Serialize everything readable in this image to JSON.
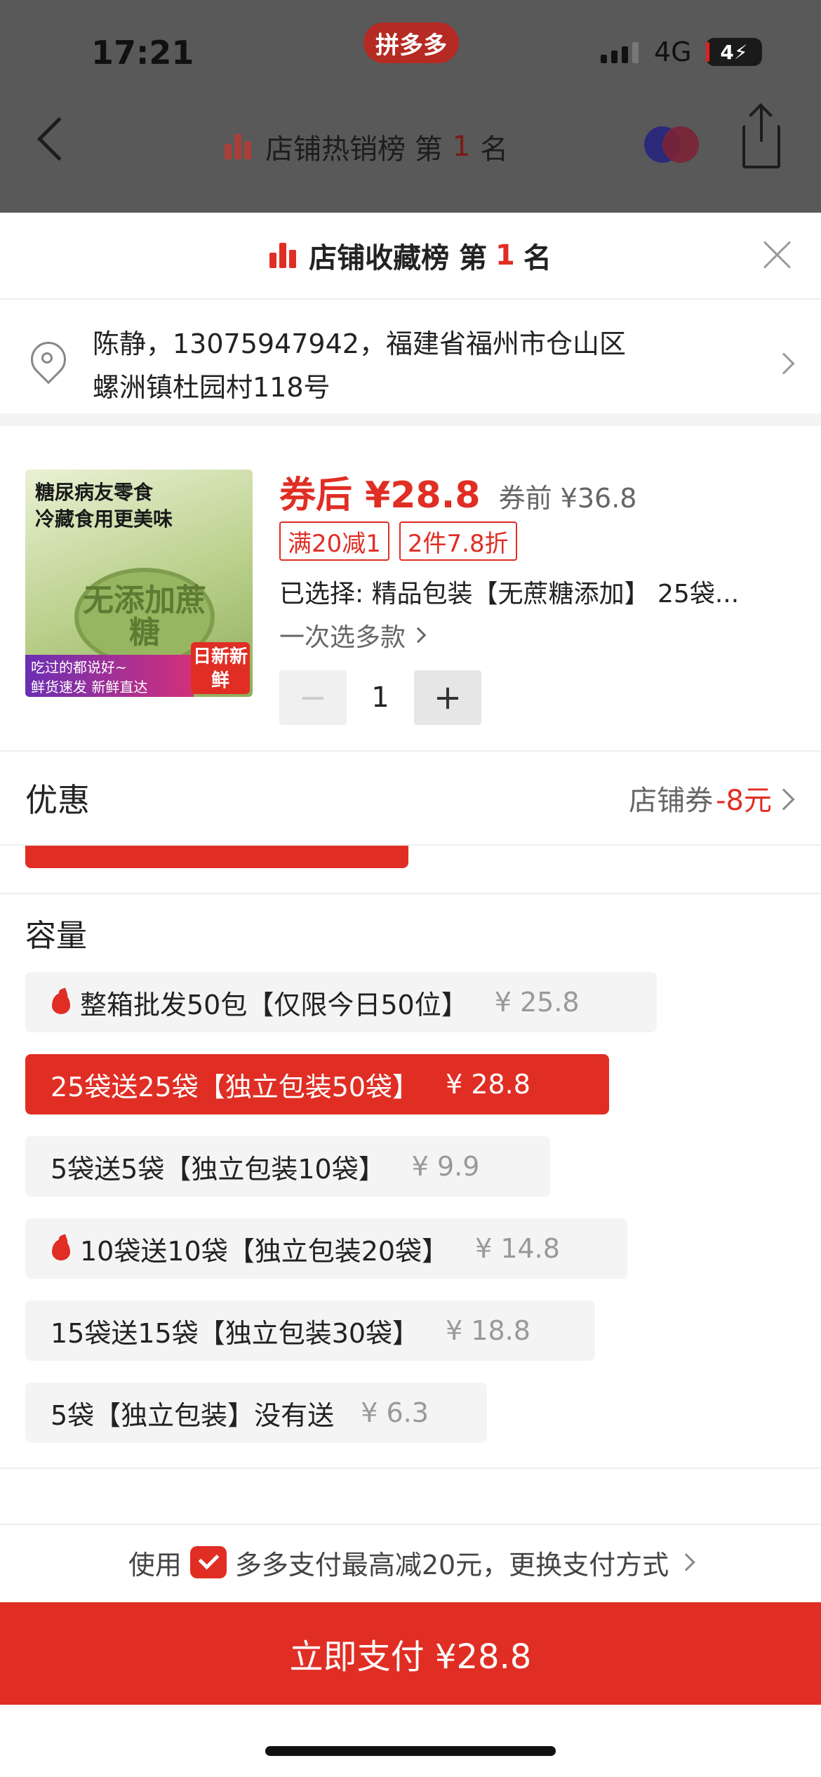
{
  "status_bar": {
    "time": "17:21",
    "app_pill": "拼多多",
    "network": "4G",
    "battery": "4"
  },
  "nav": {
    "title": "店铺热销榜 第",
    "rank": "1",
    "suffix": "名"
  },
  "sheet": {
    "rank_banner": {
      "prefix": "店铺收藏榜 第",
      "rank": "1",
      "suffix": "名"
    },
    "address": {
      "line1": "陈静，13075947942，福建省福州市仓山区",
      "line2": "螺洲镇杜园村118号"
    },
    "product": {
      "image_text": {
        "line1": "糖尿病友零食",
        "line2": "冷藏食用更美味",
        "cake_text": "无添加蔗糖",
        "band1": "吃过的都说好~",
        "band2": "鲜货速发 新鲜直达",
        "badge": "日新新鲜"
      },
      "price_now": "券后 ¥28.8",
      "price_old": "券前 ¥36.8",
      "tags": [
        "满20减1",
        "2件7.8折"
      ],
      "selected": "已选择: 精品包装【无蔗糖添加】 25袋...",
      "multi_select": "一次选多款",
      "quantity": "1",
      "minus": "−",
      "plus": "+"
    },
    "discount": {
      "label": "优惠",
      "coupon_label": "店铺券",
      "coupon_value": "-8元"
    },
    "capacity": {
      "title": "容量",
      "options": [
        {
          "label": "整箱批发50包【仅限今日50位】",
          "price": "¥ 25.8",
          "hot": true,
          "selected": false
        },
        {
          "label": "25袋送25袋【独立包装50袋】",
          "price": "¥ 28.8",
          "hot": false,
          "selected": true
        },
        {
          "label": "5袋送5袋【独立包装10袋】",
          "price": "¥ 9.9",
          "hot": false,
          "selected": false
        },
        {
          "label": "10袋送10袋【独立包装20袋】",
          "price": "¥ 14.8",
          "hot": true,
          "selected": false
        },
        {
          "label": "15袋送15袋【独立包装30袋】",
          "price": "¥ 18.8",
          "hot": false,
          "selected": false
        },
        {
          "label": "5袋【独立包装】没有送",
          "price": "¥ 6.3",
          "hot": false,
          "selected": false
        }
      ]
    },
    "pay_tip": {
      "prefix": "使用",
      "text": "多多支付最高减20元，更换支付方式"
    },
    "pay_button": "立即支付 ¥28.8"
  },
  "colors": {
    "accent": "#e02e24",
    "overlay": "#595959"
  }
}
